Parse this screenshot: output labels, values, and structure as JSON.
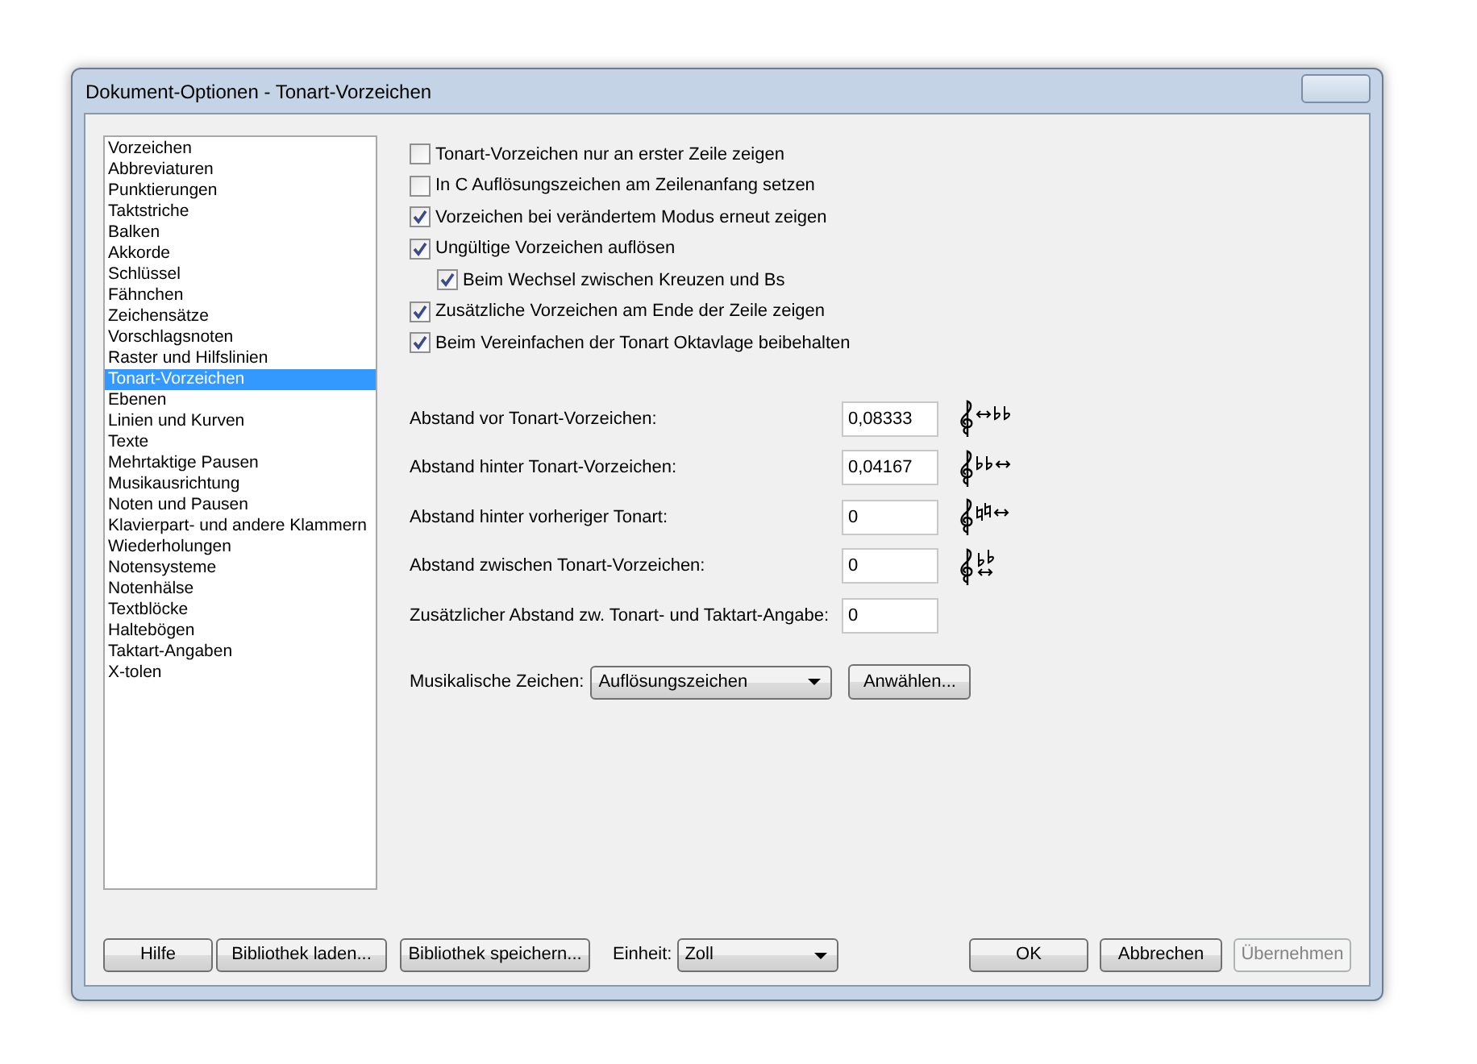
{
  "window": {
    "title": "Dokument-Optionen - Tonart-Vorzeichen"
  },
  "sidebar": {
    "items": [
      {
        "label": "Vorzeichen",
        "selected": false
      },
      {
        "label": "Abbreviaturen",
        "selected": false
      },
      {
        "label": "Punktierungen",
        "selected": false
      },
      {
        "label": "Taktstriche",
        "selected": false
      },
      {
        "label": "Balken",
        "selected": false
      },
      {
        "label": "Akkorde",
        "selected": false
      },
      {
        "label": "Schlüssel",
        "selected": false
      },
      {
        "label": "Fähnchen",
        "selected": false
      },
      {
        "label": "Zeichensätze",
        "selected": false
      },
      {
        "label": "Vorschlagsnoten",
        "selected": false
      },
      {
        "label": "Raster und Hilfslinien",
        "selected": false
      },
      {
        "label": "Tonart-Vorzeichen",
        "selected": true
      },
      {
        "label": "Ebenen",
        "selected": false
      },
      {
        "label": "Linien und Kurven",
        "selected": false
      },
      {
        "label": "Texte",
        "selected": false
      },
      {
        "label": "Mehrtaktige Pausen",
        "selected": false
      },
      {
        "label": "Musikausrichtung",
        "selected": false
      },
      {
        "label": "Noten und Pausen",
        "selected": false
      },
      {
        "label": "Klavierpart- und andere Klammern",
        "selected": false
      },
      {
        "label": "Wiederholungen",
        "selected": false
      },
      {
        "label": "Notensysteme",
        "selected": false
      },
      {
        "label": "Notenhälse",
        "selected": false
      },
      {
        "label": "Textblöcke",
        "selected": false
      },
      {
        "label": "Haltebögen",
        "selected": false
      },
      {
        "label": "Taktart-Angaben",
        "selected": false
      },
      {
        "label": "X-tolen",
        "selected": false
      }
    ]
  },
  "options": [
    {
      "label": "Tonart-Vorzeichen nur an erster Zeile zeigen",
      "checked": false
    },
    {
      "label": "In C Auflösungszeichen am Zeilenanfang setzen",
      "checked": false
    },
    {
      "label": "Vorzeichen bei verändertem Modus erneut zeigen",
      "checked": true
    },
    {
      "label": "Ungültige Vorzeichen auflösen",
      "checked": true,
      "children": [
        {
          "label": "Beim Wechsel zwischen Kreuzen und Bs",
          "checked": true
        }
      ]
    },
    {
      "label": "Zusätzliche Vorzeichen am Ende der Zeile zeigen",
      "checked": true
    },
    {
      "label": "Beim Vereinfachen der Tonart Oktavlage beibehalten",
      "checked": true
    }
  ],
  "fields": [
    {
      "label": "Abstand vor Tonart-Vorzeichen:",
      "value": "0,08333",
      "kind": "before"
    },
    {
      "label": "Abstand hinter Tonart-Vorzeichen:",
      "value": "0,04167",
      "kind": "after"
    },
    {
      "label": "Abstand hinter vorheriger Tonart:",
      "value": "0",
      "kind": "previous"
    },
    {
      "label": "Abstand zwischen Tonart-Vorzeichen:",
      "value": "0",
      "kind": "between"
    },
    {
      "label": "Zusätzlicher Abstand zw. Tonart- und Taktart-Angabe:",
      "value": "0",
      "kind": "plain"
    }
  ],
  "symbols": {
    "label": "Musikalische Zeichen:",
    "value": "Auflösungszeichen",
    "button": "Anwählen..."
  },
  "footer": {
    "left_buttons": [
      {
        "label": "Hilfe",
        "disabled": false
      },
      {
        "label": "Bibliothek laden...",
        "disabled": false
      },
      {
        "label": "Bibliothek speichern...",
        "disabled": false
      }
    ],
    "unit_label": "Einheit:",
    "unit_value": "Zoll",
    "right_buttons": [
      {
        "label": "OK",
        "disabled": false
      },
      {
        "label": "Abbrechen",
        "disabled": false
      },
      {
        "label": "Übernehmen",
        "disabled": true
      }
    ]
  }
}
